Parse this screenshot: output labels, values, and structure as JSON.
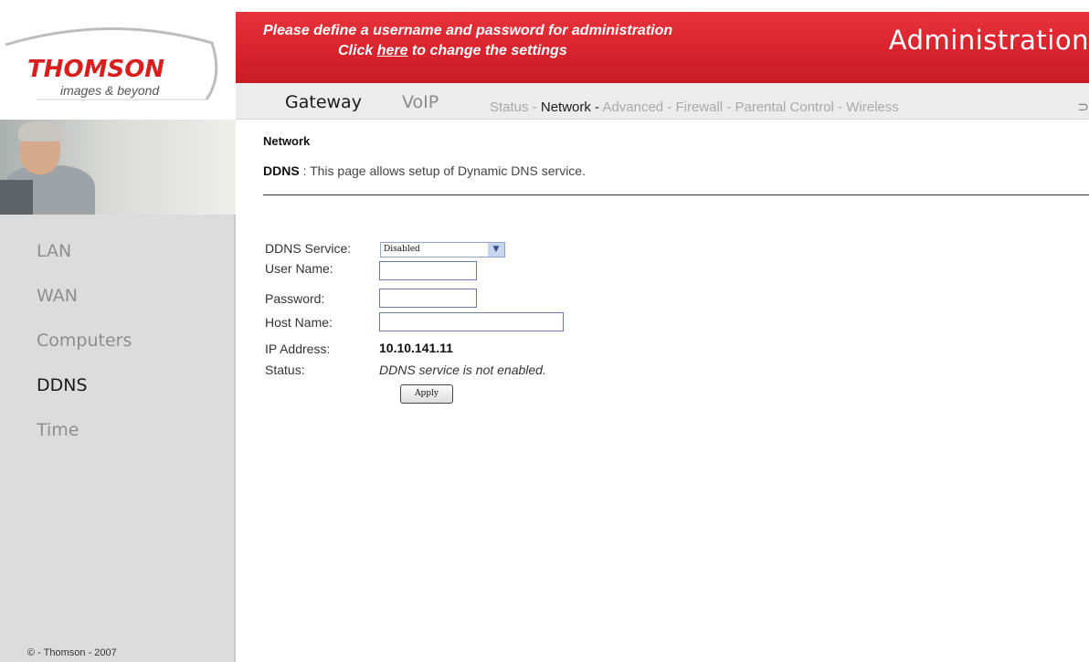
{
  "brand": {
    "name": "THOMSON",
    "tagline": "images & beyond",
    "accent_color": "#d81e1e"
  },
  "header": {
    "notice_line1": "Please define a username and password for administration",
    "notice_line2_before": "Click ",
    "notice_link": "here",
    "notice_line2_after": " to change the settings",
    "title": "Administration"
  },
  "nav": {
    "main_tabs": [
      {
        "label": "Gateway",
        "active": true
      },
      {
        "label": "VoIP",
        "active": false
      }
    ],
    "sub_tabs": [
      {
        "label": "Status",
        "active": false
      },
      {
        "label": "Network",
        "active": true
      },
      {
        "label": "Advanced",
        "active": false
      },
      {
        "label": "Firewall",
        "active": false
      },
      {
        "label": "Parental Control",
        "active": false
      },
      {
        "label": "Wireless",
        "active": false
      }
    ],
    "separator": " - ",
    "trailing_glyph": "⊃"
  },
  "sidebar": {
    "items": [
      {
        "label": "LAN",
        "active": false
      },
      {
        "label": "WAN",
        "active": false
      },
      {
        "label": "Computers",
        "active": false
      },
      {
        "label": "DDNS",
        "active": true
      },
      {
        "label": "Time",
        "active": false
      }
    ],
    "copyright": "© - Thomson - 2007"
  },
  "page": {
    "section": "Network",
    "desc_title": "DDNS",
    "desc_text": " :  This page allows setup of Dynamic DNS service."
  },
  "form": {
    "service_label": "DDNS Service:",
    "service_value": "Disabled",
    "username_label": "User Name:",
    "username_value": "",
    "password_label": "Password:",
    "password_value": "",
    "hostname_label": "Host Name:",
    "hostname_value": "",
    "ip_label": "IP Address:",
    "ip_value": "10.10.141.11",
    "status_label": "Status:",
    "status_value": "DDNS service is not enabled.",
    "apply_label": "Apply"
  }
}
